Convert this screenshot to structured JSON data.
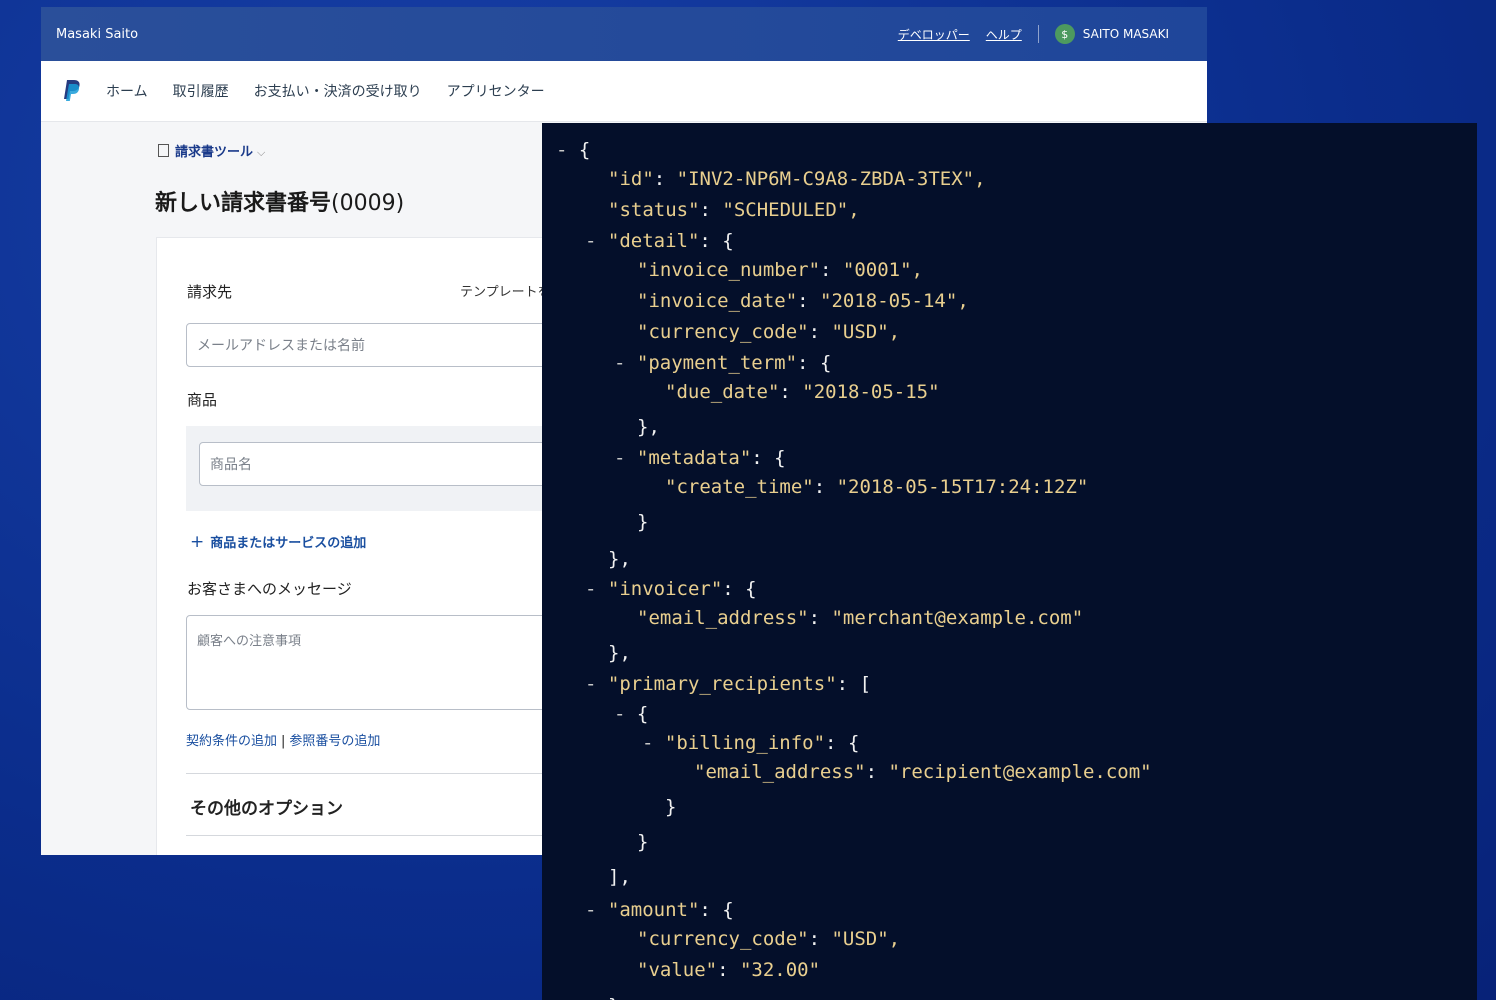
{
  "paypal": {
    "owner_name": "Masaki Saito",
    "header_links": [
      "デベロッパー",
      "ヘルプ"
    ],
    "user_name": "SAITO MASAKI",
    "nav": [
      "ホーム",
      "取引履歴",
      "お支払い・決済の受け取り",
      "アプリセンター"
    ],
    "breadcrumb": "請求書ツール",
    "page_title": "新しい請求書番号",
    "page_title_number": "(0009)",
    "form": {
      "bill_to_label": "請求先",
      "template_text": "テンプレートを",
      "email_placeholder": "メールアドレスまたは名前",
      "items_label": "商品",
      "item_name_placeholder": "商品名",
      "add_item": "商品またはサービスの追加",
      "message_label": "お客さまへのメッセージ",
      "message_placeholder": "顧客への注意事項",
      "terms_link": "契約条件の追加",
      "reference_link": "参照番号の追加",
      "other_options": "その他のオプション"
    }
  },
  "json_view": {
    "lines": [
      {
        "m": "-",
        "t": "{"
      },
      {
        "k": "\"id\"",
        "v": "\"INV2-NP6M-C9A8-ZBDA-3TEX\","
      },
      {
        "k": "\"status\"",
        "v": "\"SCHEDULED\","
      },
      {
        "m": "-",
        "k": "\"detail\"",
        "v": "{"
      },
      {
        "k": "\"invoice_number\"",
        "v": "\"0001\","
      },
      {
        "k": "\"invoice_date\"",
        "v": "\"2018-05-14\","
      },
      {
        "k": "\"currency_code\"",
        "v": "\"USD\","
      },
      {
        "m": "-",
        "k": "\"payment_term\"",
        "v": "{"
      },
      {
        "k": "\"due_date\"",
        "v": "\"2018-05-15\""
      },
      {
        "t": "},"
      },
      {
        "m": "-",
        "k": "\"metadata\"",
        "v": "{"
      },
      {
        "k": "\"create_time\"",
        "v": "\"2018-05-15T17:24:12Z\""
      },
      {
        "t": "}"
      },
      {
        "t": "},"
      },
      {
        "m": "-",
        "k": "\"invoicer\"",
        "v": "{"
      },
      {
        "k": "\"email_address\"",
        "v": "\"merchant@example.com\""
      },
      {
        "t": "},"
      },
      {
        "m": "-",
        "k": "\"primary_recipients\"",
        "v": "["
      },
      {
        "m": "-",
        "t": "{"
      },
      {
        "m": "-",
        "k": "\"billing_info\"",
        "v": "{"
      },
      {
        "k": "\"email_address\"",
        "v": "\"recipient@example.com\""
      },
      {
        "t": "}"
      },
      {
        "t": "}"
      },
      {
        "t": "],"
      },
      {
        "m": "-",
        "k": "\"amount\"",
        "v": "{"
      },
      {
        "k": "\"currency_code\"",
        "v": "\"USD\","
      },
      {
        "k": "\"value\"",
        "v": "\"32.00\""
      },
      {
        "t": "},"
      }
    ]
  }
}
